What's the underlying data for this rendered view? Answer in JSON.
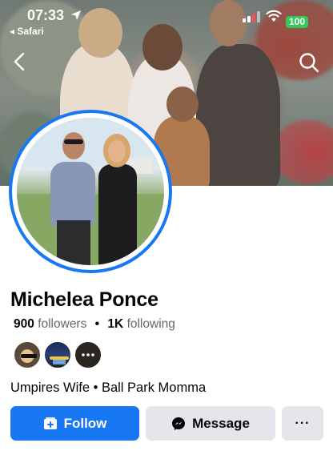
{
  "status_bar": {
    "time": "07:33",
    "back_app": "◂ Safari",
    "battery": "100"
  },
  "profile": {
    "name": "Michelea Ponce",
    "followers_count": "900",
    "followers_label": "followers",
    "following_count": "1K",
    "following_label": "following",
    "separator": "•",
    "bio": "Umpires Wife • Ball Park Momma"
  },
  "actions": {
    "follow_label": "Follow",
    "message_label": "Message",
    "more_label": "···"
  },
  "icons": {
    "location": "location-arrow-icon",
    "back": "chevron-left-icon",
    "search": "search-icon",
    "follow": "add-friend-icon",
    "message": "messenger-icon"
  },
  "colors": {
    "accent": "#1877f2",
    "secondary_button": "#e4e6eb",
    "battery": "#34c759",
    "muted_text": "#65676b"
  }
}
